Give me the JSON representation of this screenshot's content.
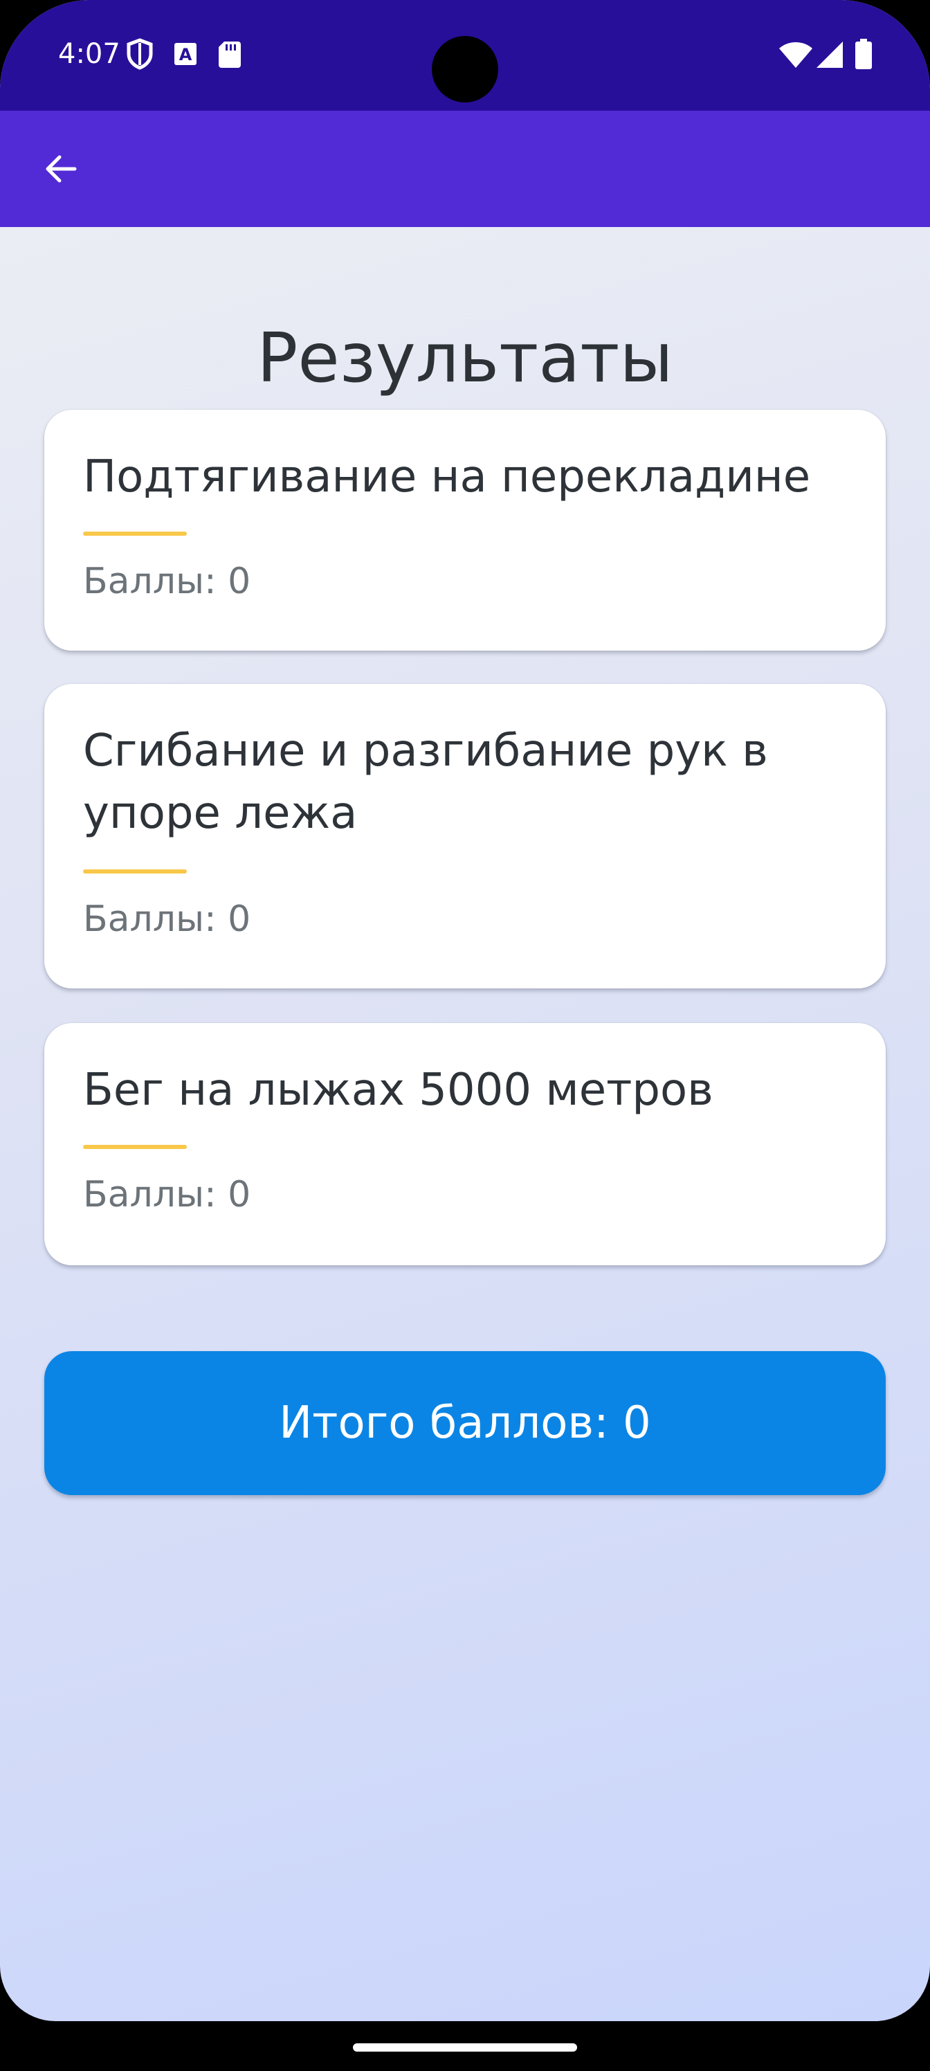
{
  "status_bar": {
    "time": "4:07",
    "left_icons": [
      "shield-icon",
      "text-a-icon",
      "sd-card-icon"
    ],
    "right_icons": [
      "wifi-icon",
      "signal-icon",
      "battery-icon"
    ],
    "background": "#280f9a"
  },
  "app_bar": {
    "back_icon": "arrow-left-icon",
    "background": "#522bd6"
  },
  "page": {
    "title": "Результаты"
  },
  "results": [
    {
      "title": "Подтягивание на перекладине",
      "score_label": "Баллы: 0"
    },
    {
      "title": "Сгибание и разгибание рук в упоре лежа",
      "score_label": "Баллы: 0"
    },
    {
      "title": "Бег на лыжах 5000 метров",
      "score_label": "Баллы: 0"
    }
  ],
  "total": {
    "label": "Итого баллов: 0",
    "background": "#0b85e5"
  },
  "colors": {
    "accent_underline": "#f8c84a",
    "title_text": "#2c3236",
    "score_text": "#6c7379"
  }
}
